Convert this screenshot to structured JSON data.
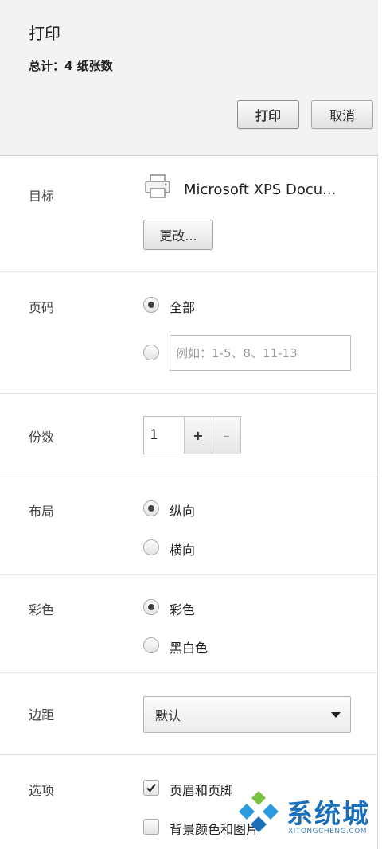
{
  "header": {
    "title": "打印",
    "summary": "总计：4 纸张数",
    "print_button": "打印",
    "cancel_button": "取消"
  },
  "destination": {
    "label": "目标",
    "printer_name": "Microsoft XPS Docu...",
    "change_button": "更改..."
  },
  "pages": {
    "label": "页码",
    "option_all": "全部",
    "custom_placeholder": "例如：1-5、8、11-13",
    "selected": "全部"
  },
  "copies": {
    "label": "份数",
    "value": "1",
    "increment": "+",
    "decrement": "–"
  },
  "layout": {
    "label": "布局",
    "option_portrait": "纵向",
    "option_landscape": "横向",
    "selected": "纵向"
  },
  "color": {
    "label": "彩色",
    "option_color": "彩色",
    "option_bw": "黑白色",
    "selected": "彩色"
  },
  "margins": {
    "label": "边距",
    "selected": "默认"
  },
  "options": {
    "label": "选项",
    "headers_footers": "页眉和页脚",
    "headers_footers_checked": true,
    "background": "背景颜色和图片",
    "background_checked": false
  },
  "watermark": {
    "text": "系统城",
    "sub": "XITONGCHENG.COM"
  },
  "colors": {
    "header_bg": "#f3f3f3",
    "watermark_blue": "#1a6fb8",
    "watermark_green": "#7cc242"
  }
}
